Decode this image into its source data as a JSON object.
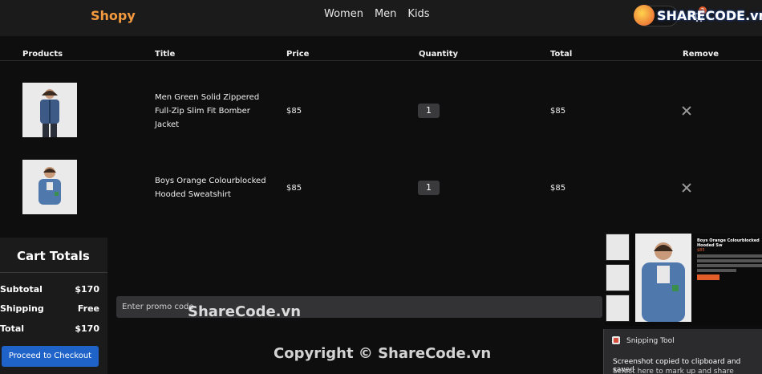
{
  "navbar": {
    "logo": "Shopy",
    "links": [
      "Women",
      "Men",
      "Kids"
    ],
    "cart_count": "2"
  },
  "watermark": {
    "top": "SHARECODE.vn",
    "center": "ShareCode.vn",
    "bottom": "Copyright © ShareCode.vn"
  },
  "table": {
    "headers": [
      "Products",
      "Title",
      "Price",
      "Quantity",
      "Total",
      "Remove"
    ],
    "rows": [
      {
        "title": "Men Green Solid Zippered Full-Zip Slim Fit Bomber Jacket",
        "price": "$85",
        "quantity": "1",
        "total": "$85"
      },
      {
        "title": "Boys Orange Colourblocked Hooded Sweatshirt",
        "price": "$85",
        "quantity": "1",
        "total": "$85"
      }
    ]
  },
  "totals": {
    "title": "Cart Totals",
    "subtotal_label": "Subtotal",
    "subtotal_value": "$170",
    "shipping_label": "Shipping",
    "shipping_value": "Free",
    "total_label": "Total",
    "total_value": "$170",
    "checkout_label": "Proceed to Checkout"
  },
  "promo": {
    "placeholder": "Enter promo code"
  },
  "preview": {
    "title": "Boys Orange Colourblocked Hooded Sw",
    "price": "$85"
  },
  "toast": {
    "app": "Snipping Tool",
    "message": "Screenshot copied to clipboard and saved",
    "sub": "Select here to mark up and share"
  },
  "colors": {
    "accent": "#f39a3f",
    "button": "#1f63c9",
    "background": "#0e0e0f"
  }
}
